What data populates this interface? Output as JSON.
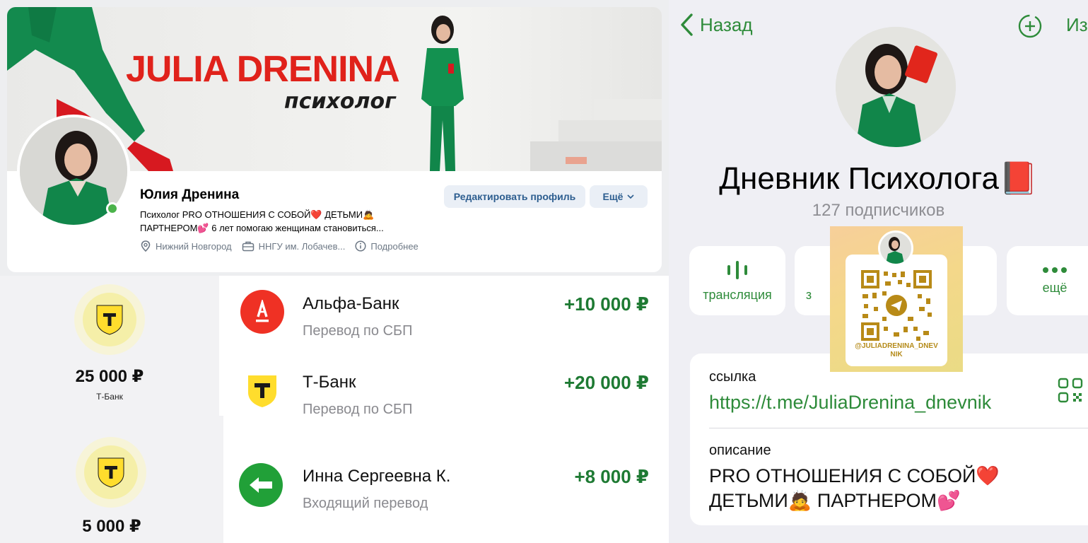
{
  "vk": {
    "cover_title": "JULIA DRENINA",
    "cover_subtitle": "психолог",
    "name": "Юлия Дренина",
    "description_line1": "Психолог PRO ОТНОШЕНИЯ С СОБОЙ❤️ ДЕТЬМИ🙇",
    "description_line2": "ПАРТНЕРОМ💕 6 лет помогаю женщинам становиться...",
    "location": "Нижний Новгород",
    "education": "ННГУ им. Лобачев...",
    "details": "Подробнее",
    "edit_button": "Редактировать профиль",
    "more_button": "Ещё",
    "colors": {
      "brand_red": "#e0221b",
      "link_blue": "#2c5d8f",
      "online_green": "#4bb34b"
    }
  },
  "bank_left": {
    "items": [
      {
        "amount": "25 000 ₽",
        "bank": "Т-Банк"
      },
      {
        "amount": "5 000 ₽",
        "bank": ""
      }
    ]
  },
  "transactions": [
    {
      "name": "Альфа-Банк",
      "type": "Перевод по СБП",
      "amount": "+10 000 ₽",
      "icon": "alfa-bank-icon",
      "color": "#ef3124"
    },
    {
      "name": "Т-Банк",
      "type": "Перевод по СБП",
      "amount": "+20 000 ₽",
      "icon": "t-bank-icon",
      "color": "#ffdd2d"
    },
    {
      "name": "Инна Сергеевна К.",
      "type": "Входящий перевод",
      "amount": "+8 000 ₽",
      "icon": "incoming-transfer-icon",
      "color": "#21a038"
    }
  ],
  "telegram": {
    "back": "Назад",
    "edit": "Изм",
    "title": "Дневник Психолога📕",
    "subscribers": "127 подписчиков",
    "actions": [
      {
        "label": "трансляция",
        "icon": "broadcast-icon"
      },
      {
        "label": "з",
        "icon": "hidden-icon"
      },
      {
        "label": "",
        "icon": "hidden-icon"
      },
      {
        "label": "ещё",
        "icon": "more-dots-icon"
      }
    ],
    "link_label": "ссылка",
    "link": "https://t.me/JuliaDrenina_dnevnik",
    "description_label": "описание",
    "description_line1": "PRO ОТНОШЕНИЯ С СОБОЙ❤️",
    "description_line2": "ДЕТЬМИ🙇 ПАРТНЕРОМ💕",
    "qr_handle_line1": "@JULIADRENINA_DNEV",
    "qr_handle_line2": "NIK",
    "accent_color": "#2e8b3a"
  }
}
